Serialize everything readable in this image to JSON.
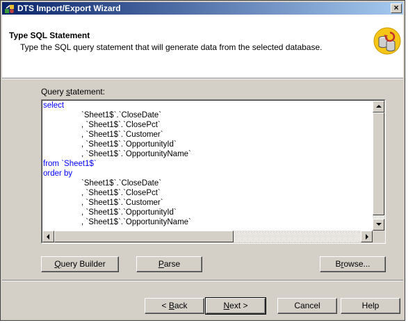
{
  "window": {
    "title": "DTS Import/Export Wizard",
    "close_glyph": "×"
  },
  "header": {
    "title": "Type SQL Statement",
    "subtitle": "Type the SQL query statement that will generate data from the selected database.",
    "icon": "database-refresh-icon"
  },
  "query": {
    "label_pre": "Query ",
    "label_mnemonic": "s",
    "label_post": "tatement:",
    "lines": [
      "select",
      "`Sheet1$`.`CloseDate`",
      ", `Sheet1$`.`ClosePct`",
      ", `Sheet1$`.`Customer`",
      ", `Sheet1$`.`OpportunityId`",
      ", `Sheet1$`.`OpportunityName`",
      "from `Sheet1$`",
      "order by",
      "`Sheet1$`.`CloseDate`",
      ", `Sheet1$`.`ClosePct`",
      ", `Sheet1$`.`Customer`",
      ", `Sheet1$`.`OpportunityId`",
      ", `Sheet1$`.`OpportunityName`"
    ]
  },
  "buttons": {
    "query_builder": {
      "mnemonic": "Q",
      "rest": "uery Builder"
    },
    "parse": {
      "mnemonic": "P",
      "rest": "arse"
    },
    "browse": {
      "pre": "B",
      "mnemonic": "r",
      "rest": "owse..."
    },
    "back": {
      "pre": "< ",
      "mnemonic": "B",
      "rest": "ack"
    },
    "next": {
      "mnemonic": "N",
      "rest": "ext >"
    },
    "cancel": "Cancel",
    "help": "Help"
  },
  "colors": {
    "keyword": "#0000ff",
    "titlebar": "#0a246a",
    "face": "#d4d0c8"
  }
}
